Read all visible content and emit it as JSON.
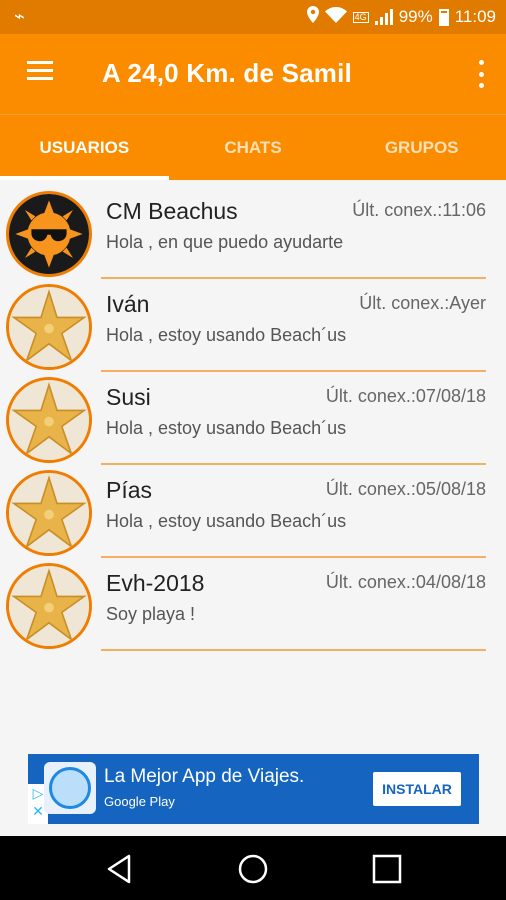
{
  "status_bar": {
    "battery": "99%",
    "time": "11:09",
    "network": "4G",
    "icons": [
      "usb-icon",
      "location-icon",
      "wifi-icon",
      "signal-icon",
      "battery-icon"
    ]
  },
  "app_bar": {
    "title": "A 24,0 Km. de Samil",
    "icons": [
      "menu-icon",
      "overflow-icon"
    ]
  },
  "tabs": [
    {
      "label": "USUARIOS",
      "active": true
    },
    {
      "label": "CHATS",
      "active": false
    },
    {
      "label": "GRUPOS",
      "active": false
    }
  ],
  "users": [
    {
      "name": "CM Beachus",
      "last_conn": "Últ. conex.:11:06",
      "message": "Hola , en que puedo ayudarte",
      "avatar": "sun-sunglasses-icon"
    },
    {
      "name": "Iván",
      "last_conn": "Últ. conex.:Ayer",
      "message": "Hola , estoy usando Beach´us",
      "avatar": "starfish-icon"
    },
    {
      "name": "Susi",
      "last_conn": "Últ. conex.:07/08/18",
      "message": "Hola , estoy usando Beach´us",
      "avatar": "starfish-icon"
    },
    {
      "name": "Pías",
      "last_conn": "Últ. conex.:05/08/18",
      "message": "Hola , estoy usando Beach´us",
      "avatar": "starfish-icon"
    },
    {
      "name": "Evh-2018",
      "last_conn": "Últ. conex.:04/08/18",
      "message": "Soy playa !",
      "avatar": "starfish-icon"
    }
  ],
  "ad": {
    "headline": "La Mejor App de Viajes.",
    "store": "Google Play",
    "cta": "INSTALAR"
  },
  "nav_bar": {
    "icons": [
      "back-icon",
      "home-icon",
      "recents-icon"
    ]
  },
  "colors": {
    "primary": "#fb8c00",
    "primary_dark": "#e07b00",
    "divider": "#f4b062",
    "ad_blue": "#1565c0"
  }
}
